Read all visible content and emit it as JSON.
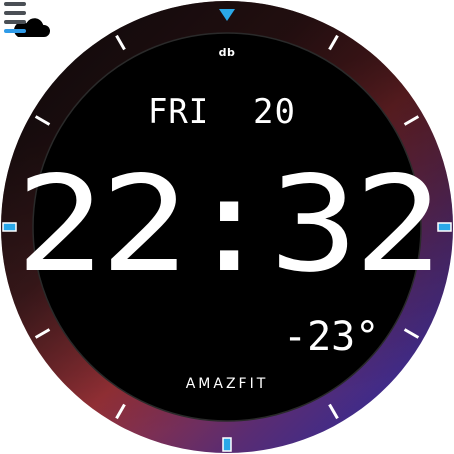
{
  "watch_face": {
    "brand_top": "db",
    "day": "FRI",
    "date": "20",
    "hour": "22",
    "separator": ":",
    "minute": "32",
    "temperature": "-23°",
    "brand_bottom": "AMAZFIT",
    "weather_icon": "partly-cloudy-icon",
    "battery": {
      "segments_total": 4,
      "segments_active": 1
    }
  },
  "colors": {
    "dial_background": "#000000",
    "bezel_top": "#1a1416",
    "bezel_red": "#9b3238",
    "bezel_purple": "#3a2a8a",
    "bezel_blue": "#1d2aa8",
    "marker_accent": "#2aa8e8",
    "battery_active": "#2f9be8",
    "battery_inactive": "#4a4f55"
  }
}
